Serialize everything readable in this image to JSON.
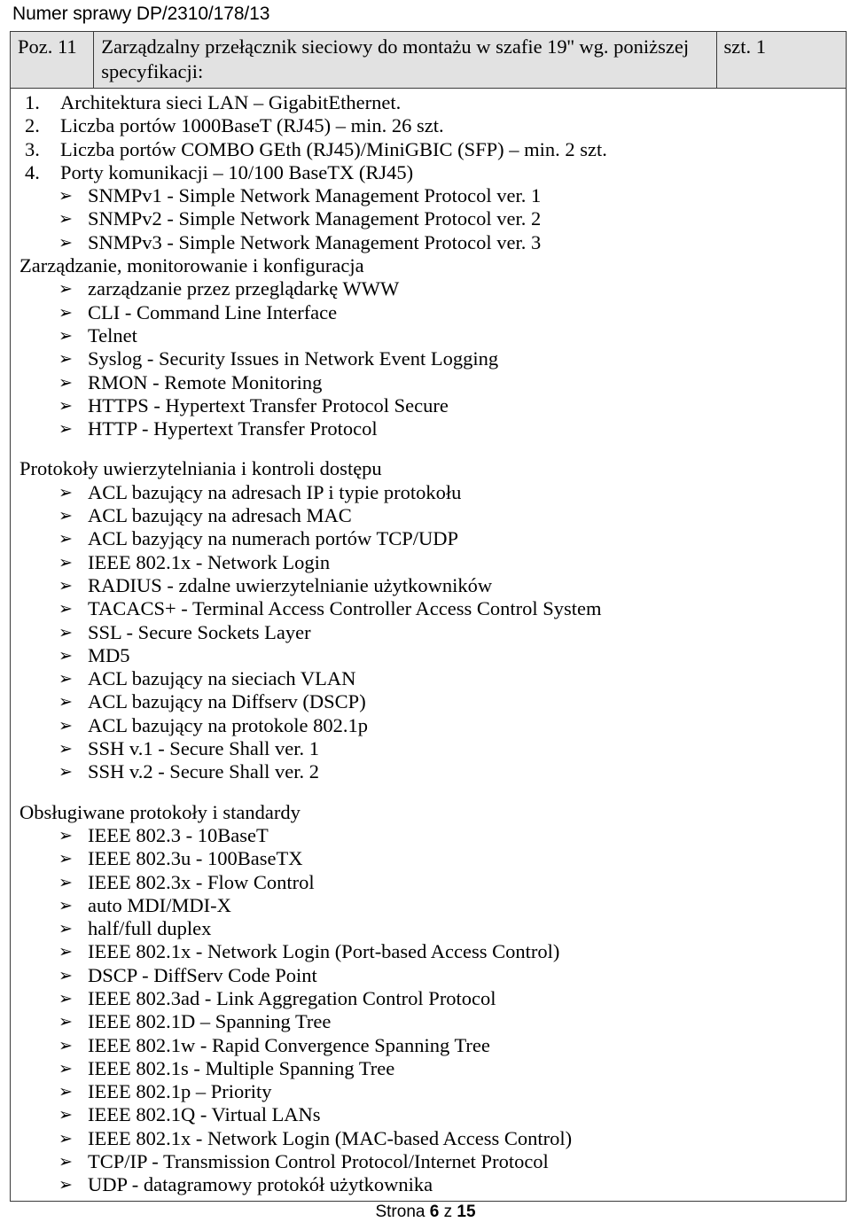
{
  "document": {
    "running_header": "Numer sprawy DP/2310/178/13",
    "footer": {
      "prefix": "Strona",
      "current_page": "6",
      "separator": "z",
      "total_pages": "15"
    }
  },
  "table": {
    "header_row": {
      "position_label": "Poz. 11",
      "description": "Zarządzalny przełącznik sieciowy do montażu w szafie 19'' wg. poniższej specyfikacji:",
      "quantity": "szt. 1"
    },
    "numbered_items": [
      {
        "num": "1.",
        "text": "Architektura sieci LAN – GigabitEthernet."
      },
      {
        "num": "2.",
        "text": "Liczba portów 1000BaseT (RJ45) – min. 26 szt."
      },
      {
        "num": "3.",
        "text": "Liczba portów COMBO GEth (RJ45)/MiniGBIC (SFP) – min. 2 szt."
      },
      {
        "num": "4.",
        "text": "Porty komunikacji – 10/100 BaseTX (RJ45)"
      }
    ],
    "snmp_items": [
      "SNMPv1 - Simple Network Management Protocol ver. 1",
      "SNMPv2 - Simple Network Management Protocol ver. 2",
      "SNMPv3 - Simple Network Management Protocol ver. 3"
    ],
    "sections": [
      {
        "heading": "Zarządzanie, monitorowanie i konfiguracja",
        "items": [
          "zarządzanie przez przeglądarkę WWW",
          "CLI - Command Line Interface",
          "Telnet",
          "Syslog - Security Issues in Network Event Logging",
          "RMON - Remote Monitoring",
          "HTTPS - Hypertext Transfer Protocol Secure",
          "HTTP - Hypertext Transfer Protocol"
        ]
      },
      {
        "heading": "Protokoły uwierzytelniania i kontroli dostępu",
        "items": [
          "ACL bazujący na adresach IP i typie protokołu",
          "ACL bazujący na adresach MAC",
          "ACL bazyjący na numerach portów TCP/UDP",
          "IEEE 802.1x - Network Login",
          "RADIUS - zdalne uwierzytelnianie użytkowników",
          "TACACS+ - Terminal Access Controller Access Control System",
          "SSL - Secure Sockets Layer",
          "MD5",
          "ACL bazujący na sieciach VLAN",
          "ACL bazujący na Diffserv (DSCP)",
          "ACL bazujący na protokole 802.1p",
          "SSH v.1 - Secure Shall ver. 1",
          "SSH v.2 - Secure Shall ver. 2"
        ]
      },
      {
        "heading": "Obsługiwane protokoły i standardy",
        "items": [
          "IEEE 802.3 - 10BaseT",
          "IEEE 802.3u - 100BaseTX",
          "IEEE 802.3x - Flow Control",
          "auto MDI/MDI-X",
          "half/full duplex",
          "IEEE 802.1x - Network Login (Port-based Access Control)",
          "DSCP - DiffServ Code Point",
          "IEEE 802.3ad - Link Aggregation Control Protocol",
          "IEEE 802.1D – Spanning Tree",
          "IEEE 802.1w - Rapid Convergence Spanning Tree",
          "IEEE 802.1s - Multiple Spanning Tree",
          "IEEE 802.1p – Priority",
          "IEEE 802.1Q - Virtual LANs",
          "IEEE 802.1x - Network Login (MAC-based Access Control)",
          "TCP/IP - Transmission Control Protocol/Internet Protocol",
          "UDP - datagramowy protokół użytkownika"
        ]
      }
    ],
    "bullet_glyph": "➢"
  },
  "colors": {
    "header_row_background": "#e2e2e2",
    "border": "#3a3a3a",
    "text": "#000000"
  }
}
